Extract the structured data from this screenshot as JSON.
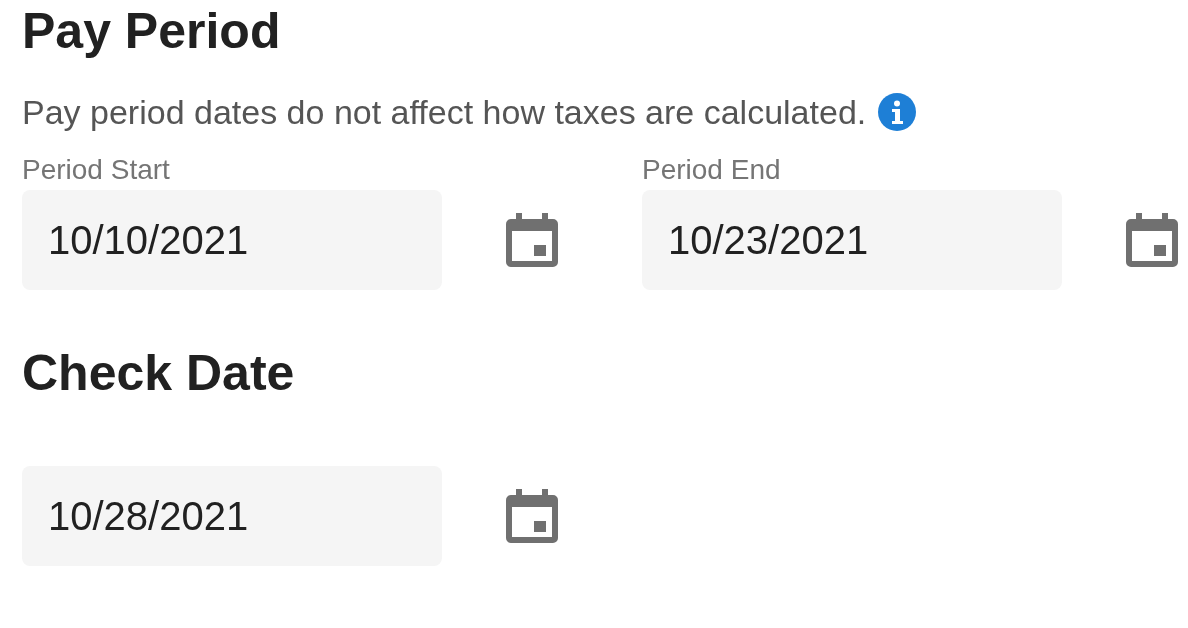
{
  "pay_period": {
    "title": "Pay Period",
    "note": "Pay period dates do not affect how taxes are calculated.",
    "fields": [
      {
        "label": "Period Start",
        "value": "10/10/2021"
      },
      {
        "label": "Period End",
        "value": "10/23/2021"
      }
    ]
  },
  "check_date": {
    "title": "Check Date",
    "fields": [
      {
        "value": "10/28/2021"
      }
    ]
  }
}
